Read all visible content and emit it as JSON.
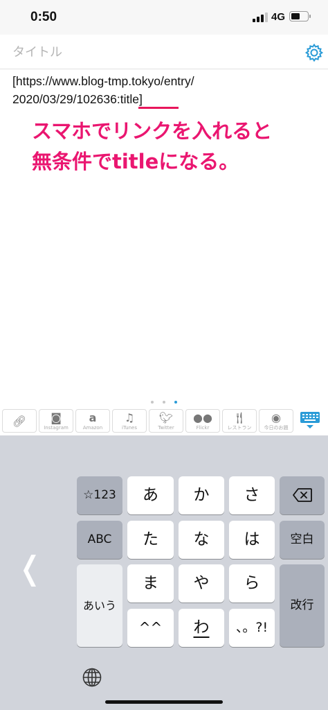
{
  "status_bar": {
    "time": "0:50",
    "network": "4G",
    "battery_level": 0.55
  },
  "editor": {
    "title_placeholder": "タイトル",
    "title_value": "",
    "settings_icon": "gear-icon",
    "body_lines": [
      "[https://www.blog-tmp.tokyo/entry/",
      "2020/03/29/102636:title]"
    ]
  },
  "annotation": {
    "line1": "スマホでリンクを入れると",
    "line2": "無条件でtitleになる。",
    "color": "#ea1670"
  },
  "toolbar": {
    "page_indicator": {
      "count": 3,
      "active": 3
    },
    "buttons": [
      {
        "icon": "link-icon",
        "label": ""
      },
      {
        "icon": "instagram-icon",
        "label": "Instagram"
      },
      {
        "icon": "amazon-icon",
        "label": "Amazon"
      },
      {
        "icon": "music-icon",
        "label": "iTunes"
      },
      {
        "icon": "twitter-icon",
        "label": "Twitter"
      },
      {
        "icon": "flickr-icon",
        "label": "Flickr"
      },
      {
        "icon": "restaurant-icon",
        "label": "レストラン"
      },
      {
        "icon": "today-icon",
        "label": "今日のお題"
      }
    ],
    "keyboard_toggle_icon": "keyboard-icon",
    "accent_color": "#2a9bd7"
  },
  "keyboard": {
    "symbols_key": "☆123",
    "abc_key": "ABC",
    "kana_key": "あいう",
    "delete_icon": "backspace-icon",
    "space_key": "空白",
    "return_key": "改行",
    "keys": [
      "あ",
      "か",
      "さ",
      "た",
      "な",
      "は",
      "ま",
      "や",
      "ら",
      "^^",
      "わ",
      "、。?!"
    ],
    "globe_icon": "globe-icon",
    "left_arrow": "❬"
  }
}
